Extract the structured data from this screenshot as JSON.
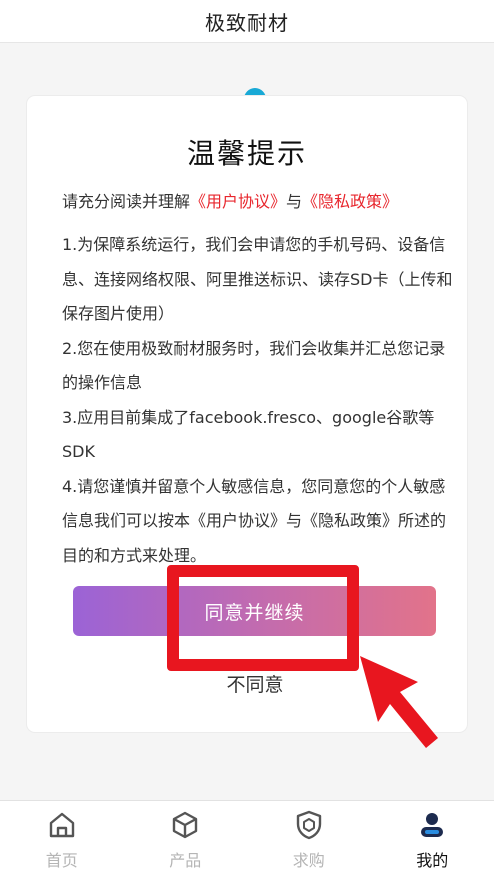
{
  "header": {
    "title": "极致耐材"
  },
  "dialog": {
    "title": "温馨提示",
    "intro_prefix": "请充分阅读并理解",
    "user_agreement_link": "《用户协议》",
    "and_text": "与",
    "privacy_policy_link": "《隐私政策》",
    "items": [
      "1.为保障系统运行，我们会申请您的手机号码、设备信息、连接网络权限、阿里推送标识、读存SD卡（上传和保存图片使用）",
      "2.您在使用极致耐材服务时，我们会收集并汇总您记录的操作信息",
      "3.应用目前集成了facebook.fresco、google谷歌等SDK",
      "4.请您谨慎并留意个人敏感信息，您同意您的个人敏感信息我们可以按本《用户协议》与《隐私政策》所述的目的和方式来处理。"
    ],
    "agree_label": "同意并继续",
    "disagree_label": "不同意"
  },
  "colors": {
    "link": "#e8262d",
    "button_gradient_start": "#9b63d6",
    "button_gradient_end": "#e2738a",
    "highlight": "#e8161f",
    "active_icon": "#1d2b4f",
    "active_icon_accent": "#2a8de0"
  },
  "tabbar": {
    "tabs": [
      {
        "label": "首页",
        "icon": "home-icon",
        "active": false
      },
      {
        "label": "产品",
        "icon": "cube-icon",
        "active": false
      },
      {
        "label": "求购",
        "icon": "shield-icon",
        "active": false
      },
      {
        "label": "我的",
        "icon": "user-icon",
        "active": true
      }
    ]
  }
}
